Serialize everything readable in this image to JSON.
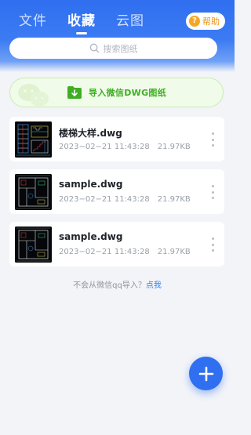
{
  "tabs": [
    {
      "label": "文件",
      "active": false
    },
    {
      "label": "收藏",
      "active": true
    },
    {
      "label": "云图",
      "active": false
    }
  ],
  "help": {
    "icon": "question-circle-icon",
    "icon_glyph": "?",
    "label": "帮助"
  },
  "search": {
    "icon": "search-icon",
    "placeholder": "搜索图纸"
  },
  "import_banner": {
    "icon": "folder-download-icon",
    "watermark_icon": "wechat-icon",
    "label": "导入微信DWG图纸"
  },
  "files": [
    {
      "name": "楼梯大样.dwg",
      "date": "2023−02−21 11:43:28",
      "size": "21.97KB",
      "thumbnail": "stair-detail-drawing"
    },
    {
      "name": "sample.dwg",
      "date": "2023−02−21 11:43:28",
      "size": "21.97KB",
      "thumbnail": "floor-plan-drawing"
    },
    {
      "name": "sample.dwg",
      "date": "2023−02−21 11:43:28",
      "size": "21.97KB",
      "thumbnail": "floor-plan-drawing"
    }
  ],
  "hint": {
    "text": "不会从微信qq导入？",
    "link": "点我"
  },
  "fab": {
    "icon": "plus-icon"
  },
  "colors": {
    "primary": "#2f6ff0",
    "import_green": "#3fae25",
    "help_orange": "#f6a623",
    "link_blue": "#2f80ed"
  }
}
